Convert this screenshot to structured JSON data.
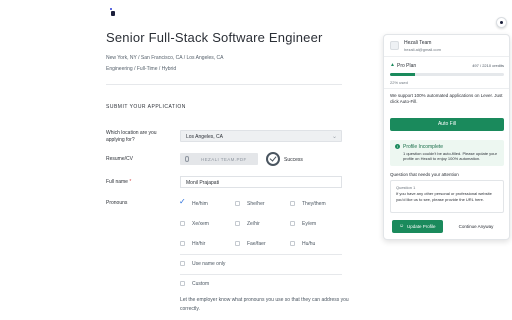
{
  "job": {
    "title": "Senior Full-Stack Software Engineer",
    "locations": "New York, NY / San Francisco, CA / Los Angeles, CA",
    "meta": "Engineering / Full-Time / Hybrid"
  },
  "form": {
    "section_title": "SUBMIT YOUR APPLICATION",
    "location_label": "Which location are you applying for?",
    "location_value": "Los Angeles, CA",
    "resume_label": "Resume/CV",
    "resume_file": "HEZALI TEAM.PDF",
    "resume_status": "Success",
    "fullname_label": "Full name",
    "fullname_required": "*",
    "fullname_value": "Monil Prajapati",
    "pronouns_label": "Pronouns",
    "pronouns": [
      {
        "label": "He/him",
        "checked": true
      },
      {
        "label": "She/her",
        "checked": false
      },
      {
        "label": "They/them",
        "checked": false
      },
      {
        "label": "Xe/xem",
        "checked": false
      },
      {
        "label": "Ze/hir",
        "checked": false
      },
      {
        "label": "Ey/em",
        "checked": false
      },
      {
        "label": "Hir/hir",
        "checked": false
      },
      {
        "label": "Fae/faer",
        "checked": false
      },
      {
        "label": "Hu/hu",
        "checked": false
      }
    ],
    "name_only_label": "Use name only",
    "custom_label": "Custom",
    "help_text": "Let the employer know what pronouns you use so that they can address you correctly."
  },
  "extension": {
    "user_name": "Hezali Team",
    "user_email": "hezali.ai@gmail.com",
    "plan_name": "Pro Plan",
    "credits": "497 / 2210 credits",
    "used_text": "22% used",
    "used_fraction": 0.22,
    "info_text": "We support 100% automated applications on Lever. Just click Auto-Fill.",
    "autofill_label": "Auto Fill",
    "incomplete_title": "Profile Incomplete",
    "incomplete_desc": "1 question couldn't be auto-filled. Please update your profile on Hezali to enjoy 100% automation.",
    "question_heading": "Question that needs your attention",
    "question_number": "Question 1",
    "question_text": "If you have any other personal or professional website you'd like us to see, please provide the URL here.",
    "update_label": "Update Profile",
    "continue_label": "Continue Anyway"
  },
  "colors": {
    "accent_green": "#1a8a5c",
    "check_blue": "#2a6fdb"
  }
}
